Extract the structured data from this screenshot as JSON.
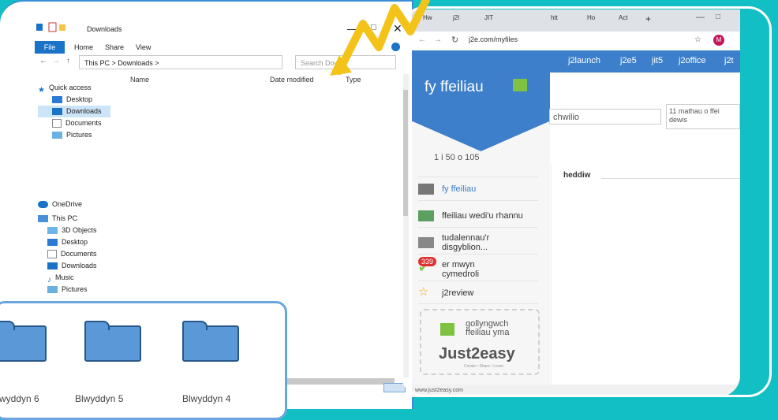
{
  "explorer": {
    "title": "Downloads",
    "ribbon": [
      "File",
      "Home",
      "Share",
      "View"
    ],
    "address": "This PC  >  Downloads  >",
    "search_placeholder": "Search Dow",
    "columns": [
      "Name",
      "Date modified",
      "Type"
    ],
    "quick_access_label": "Quick access",
    "quick_access": [
      "Desktop",
      "Downloads",
      "Documents",
      "Pictures"
    ],
    "onedrive": "OneDrive",
    "this_pc": "This PC",
    "this_pc_items": [
      "3D Objects",
      "Desktop",
      "Documents",
      "Downloads",
      "Music",
      "Pictures"
    ]
  },
  "browser": {
    "tabs": [
      "Hw",
      "j2l",
      "JIT",
      "htt",
      "Ho",
      "Act"
    ],
    "url": "j2e.com/myfiles",
    "avatar": "M",
    "top_links": [
      "j2launch",
      "j2e5",
      "jit5",
      "j2office",
      "j2t"
    ],
    "section_title": "fy ffeiliau",
    "search_value": "chwilio",
    "filter_text": "11 mathau o ffei dewis",
    "pagination": "1 i 50 o 105",
    "menu": [
      "fy ffeiliau",
      "ffeiliau wedi'u rhannu",
      "tudalennau'r disgyblion...",
      "er mwyn cymedroli",
      "j2review"
    ],
    "badge_count": "339",
    "dropzone_text": "gollyngwch ffeiliau yma",
    "brand": "Just2easy",
    "brand_tag": "Create • Share • Learn",
    "group_heading": "heddiw",
    "status_url": "www.just2easy.com"
  },
  "folders": [
    "wyddyn 6",
    "Blwyddyn 5",
    "Blwyddyn 4"
  ],
  "colors": {
    "background": "#11bfc4",
    "accent": "#3d7fcb",
    "arrow": "#f3c31a"
  }
}
